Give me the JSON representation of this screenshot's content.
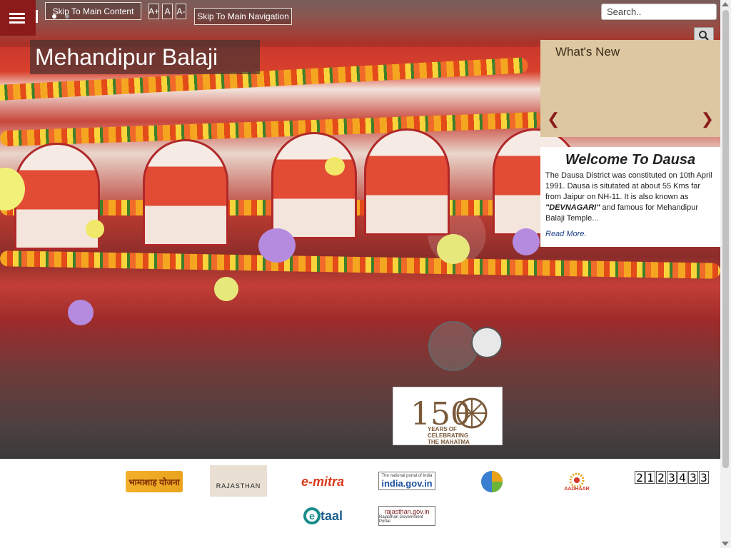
{
  "header": {
    "skip_main_content": "Skip To Main Content",
    "font_increase": "A+",
    "font_normal": "A",
    "font_decrease": "A-",
    "skip_main_navigation": "Skip To Main Navigation",
    "search_placeholder": "Search.."
  },
  "hero": {
    "title": "Mehandipur Balaji"
  },
  "whats_new": {
    "heading": "What's New",
    "prev": "❮",
    "next": "❯"
  },
  "welcome": {
    "heading": "Welcome To Dausa",
    "text_1": "The Dausa District was constituted on 10th April 1991. Dausa is situtated at about 55 Kms far from Jaipur on NH-11. It is also known as ",
    "text_bold": "\"DEVNAGARI\"",
    "text_2": " and famous for Mehandipur Balaji Temple...",
    "read_more": "Read More."
  },
  "gandhi_badge": {
    "number": "150",
    "line1": "YEARS OF",
    "line2": "CELEBRATING",
    "line3": "THE MAHATMA"
  },
  "logos": {
    "bhamashah": "भामाशाह योजना",
    "rajasthan": "RAJASTHAN",
    "emitra": "e-mitra",
    "india_gov_top": "The national portal of India",
    "india_gov": "india.gov.in",
    "aadhaar": "AADHAAR",
    "etaal": "taal",
    "rajasthan_gov": "rajasthan.gov.in",
    "rajasthan_gov_sub": "Rajasthan Government Portal"
  },
  "visitor_counter": [
    "2",
    "1",
    "2",
    "3",
    "4",
    "3",
    "3"
  ]
}
